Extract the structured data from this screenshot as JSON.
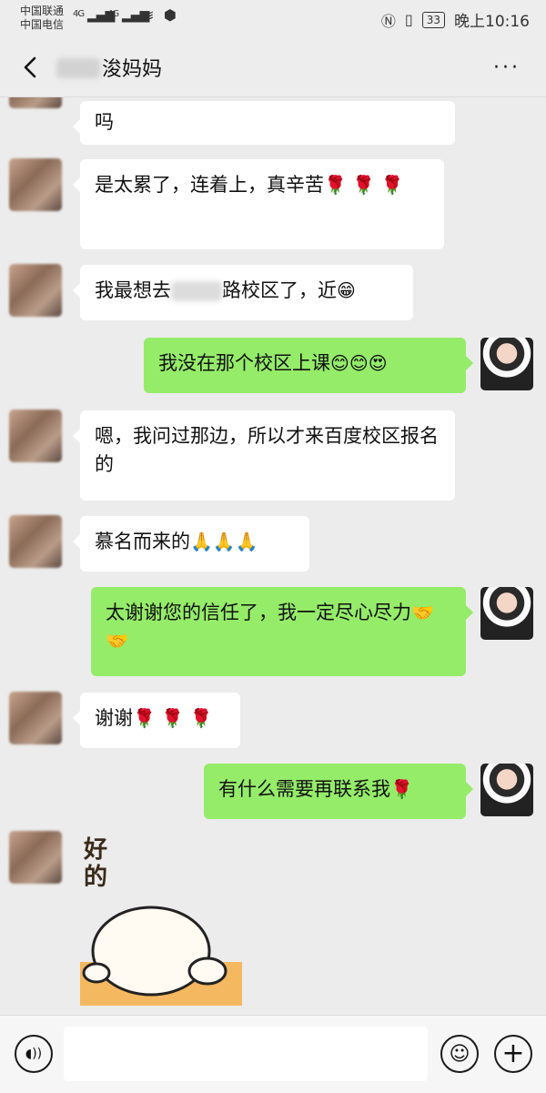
{
  "status_bar": {
    "carrier1": "中国联通",
    "carrier2": "中国电信",
    "net1": "4G",
    "net2": "4G",
    "battery": "33",
    "time": "晚上10:16"
  },
  "header": {
    "title": "浚妈妈",
    "more": "···"
  },
  "messages": [
    {
      "side": "in",
      "text": "吗",
      "emoji": ""
    },
    {
      "side": "in",
      "text": "是太累了，连着上，真辛苦",
      "emoji": "🌹 🌹 🌹"
    },
    {
      "side": "in",
      "text_a": "我最想去",
      "text_b": "路校区了，近",
      "emoji": "😁"
    },
    {
      "side": "out",
      "text": "我没在那个校区上课",
      "emoji": "😊😊😍"
    },
    {
      "side": "in",
      "text": "嗯，我问过那边，所以才来百度校区报名的",
      "emoji": ""
    },
    {
      "side": "in",
      "text": "慕名而来的",
      "emoji": "🙏🙏🙏"
    },
    {
      "side": "out",
      "text": "太谢谢您的信任了，我一定尽心尽力",
      "emoji": "🤝🤝"
    },
    {
      "side": "in",
      "text": "谢谢",
      "emoji": "🌹 🌹 🌹"
    },
    {
      "side": "out",
      "text": "有什么需要再联系我",
      "emoji": "🌹"
    }
  ],
  "sticker": {
    "text": "好\n的"
  },
  "input_bar": {
    "voice_icon": "voice-icon",
    "emoji_icon": "emoji-icon",
    "plus_icon": "plus-icon",
    "emoji_glyph": "☺",
    "plus_glyph": "+",
    "voice_glyph": "◖))"
  }
}
